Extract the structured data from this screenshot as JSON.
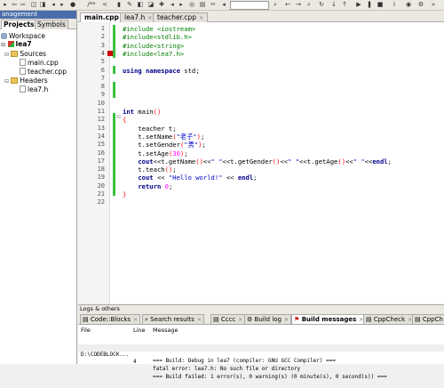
{
  "management": {
    "title": "anagement",
    "tabs": [
      "Projects",
      "Symbols"
    ],
    "tree": {
      "workspace": "Workspace",
      "project": "lea7",
      "sources": "Sources",
      "source_files": [
        "main.cpp",
        "teacher.cpp"
      ],
      "headers": "Headers",
      "header_files": [
        "lea7.h"
      ]
    }
  },
  "editor_tabs": [
    "main.cpp",
    "lea7.h",
    "teacher.cpp"
  ],
  "code_lines": [
    "#include <iostream>",
    "#include<stdlib.h>",
    "#include<string>",
    "#include<lea7.h>",
    "",
    "using namespace std;",
    "",
    "",
    "",
    "",
    "int main()",
    "{",
    "    teacher t;",
    "    t.setName(\"老子\");",
    "    t.setGender(\"男\");",
    "    t.setAge(30);",
    "    cout<<t.getName()<<\" \"<<t.getGender()<<\" \"<<t.getAge()<<\" \"<<endl;",
    "    t.teach();",
    "    cout << \"Hello world!\" << endl;",
    "    return 0;",
    "}",
    ""
  ],
  "logs": {
    "title": "Logs & others",
    "tabs": [
      "Code::Blocks",
      "Search results",
      "Cccc",
      "Build log",
      "Build messages",
      "CppCheck",
      "CppCh"
    ],
    "columns": [
      "File",
      "Line",
      "Message"
    ],
    "rows": [
      {
        "file": "",
        "line": "",
        "message": "=== Build: Debug in lea7 (compiler: GNU GCC Compiler) ==="
      },
      {
        "file": "D:\\CODEBLOCK...",
        "line": "4",
        "message": "fatal error: lea7.h: No such file or directory"
      },
      {
        "file": "",
        "line": "",
        "message": "=== Build failed: 1 error(s), 0 warning(s) (0 minute(s), 0 second(s)) ==="
      }
    ]
  },
  "colors": {
    "keyword": "#00008b",
    "preprocessor": "#008000",
    "string": "#0000cd",
    "number": "#ff00ff",
    "change_bar": "#3cbf3c",
    "error_marker": "#cc0000"
  }
}
